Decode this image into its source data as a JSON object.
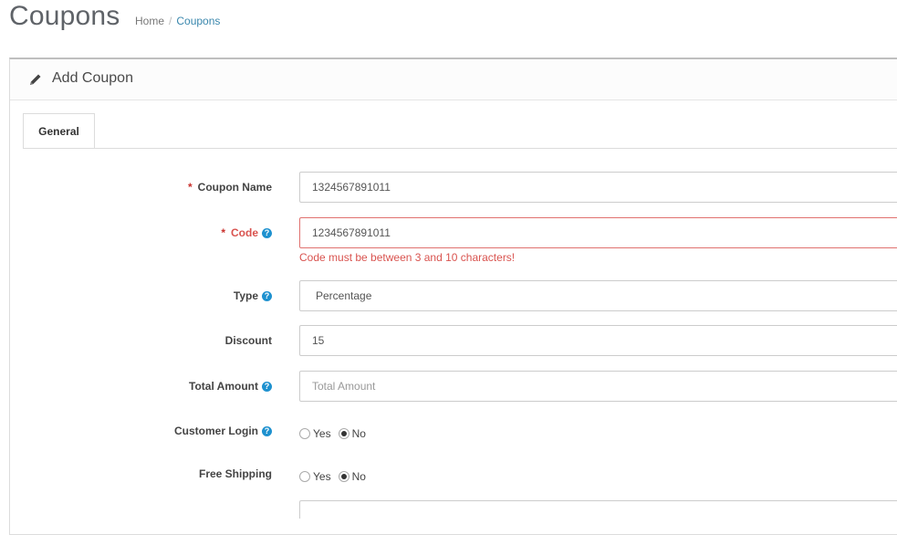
{
  "page": {
    "title": "Coupons",
    "breadcrumb": [
      {
        "label": "Home"
      },
      {
        "label": "Coupons"
      }
    ]
  },
  "panel": {
    "title": "Add Coupon",
    "icon": "pencil-icon"
  },
  "tabs": [
    {
      "label": "General",
      "active": true
    }
  ],
  "form": {
    "coupon_name": {
      "label": "Coupon Name",
      "required": "*",
      "value": "1324567891011"
    },
    "code": {
      "label": "Code",
      "required": "*",
      "value": "1234567891011",
      "error": "Code must be between 3 and 10 characters!"
    },
    "type": {
      "label": "Type",
      "value": "Percentage"
    },
    "discount": {
      "label": "Discount",
      "value": "15"
    },
    "total_amount": {
      "label": "Total Amount",
      "placeholder": "Total Amount"
    },
    "customer_login": {
      "label": "Customer Login",
      "options": [
        "Yes",
        "No"
      ],
      "selected": "No"
    },
    "free_shipping": {
      "label": "Free Shipping",
      "options": [
        "Yes",
        "No"
      ],
      "selected": "No"
    }
  },
  "help_icon": "?",
  "colors": {
    "accent": "#1e91cf",
    "error": "#d9534f",
    "breadcrumb_active": "#3a87ad"
  }
}
